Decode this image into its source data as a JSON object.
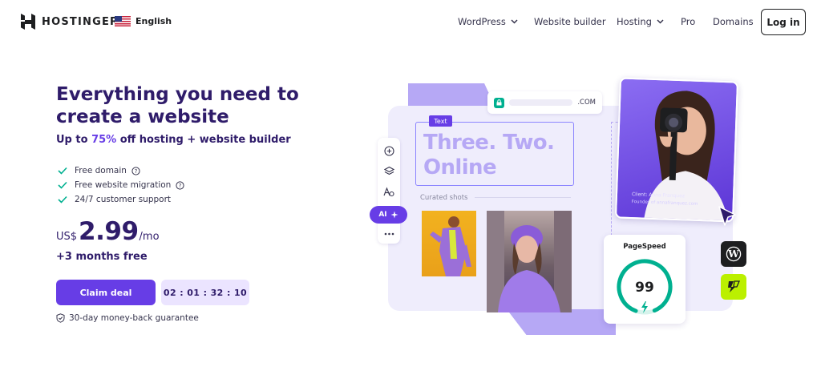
{
  "header": {
    "brand": "HOSTINGER",
    "language": "English",
    "nav": {
      "wordpress": "WordPress",
      "website_builder": "Website builder",
      "hosting": "Hosting",
      "pro": "Pro",
      "domains": "Domains"
    },
    "login": "Log in"
  },
  "hero": {
    "title": "Everything you need to create a website",
    "subtitle_prefix": "Up to ",
    "subtitle_pct": "75%",
    "subtitle_suffix": " off hosting + website builder",
    "features": [
      "Free domain",
      "Free website migration",
      "24/7 customer support"
    ],
    "price": {
      "currency": "US$",
      "amount": "2.99",
      "period": "/mo"
    },
    "bonus": "+3 months free",
    "cta": "Claim deal",
    "timer": "02 : 01 : 32 : 10",
    "guarantee": "30-day money-back guarantee"
  },
  "illustration": {
    "url_tld": ".COM",
    "text_tag": "Text",
    "headline_line1": "Three. Two.",
    "headline_line2": "Online",
    "curated": "Curated shots",
    "ai_label": "AI",
    "client_name": "Client: Anna Franquez",
    "client_site": "Founder of annafranquez.com",
    "pagespeed_title": "PageSpeed",
    "pagespeed_score": "99",
    "pagespeed_fraction": 0.99
  },
  "colors": {
    "brand_purple": "#673de6",
    "dark_purple": "#2f1c6a",
    "light_purple": "#ebe4ff",
    "lavender": "#b6a8f5",
    "success_green": "#00b090",
    "litespeed_lime": "#bbf000"
  },
  "icons": [
    "hostinger-logo-icon",
    "us-flag-icon",
    "chevron-down-icon",
    "check-icon",
    "help-circle-icon",
    "shield-icon",
    "lock-icon",
    "plus-circle-icon",
    "layers-icon",
    "text-style-icon",
    "sparkle-icon",
    "more-dots-icon",
    "cursor-icon",
    "lightning-icon",
    "wordpress-icon",
    "litespeed-icon"
  ]
}
